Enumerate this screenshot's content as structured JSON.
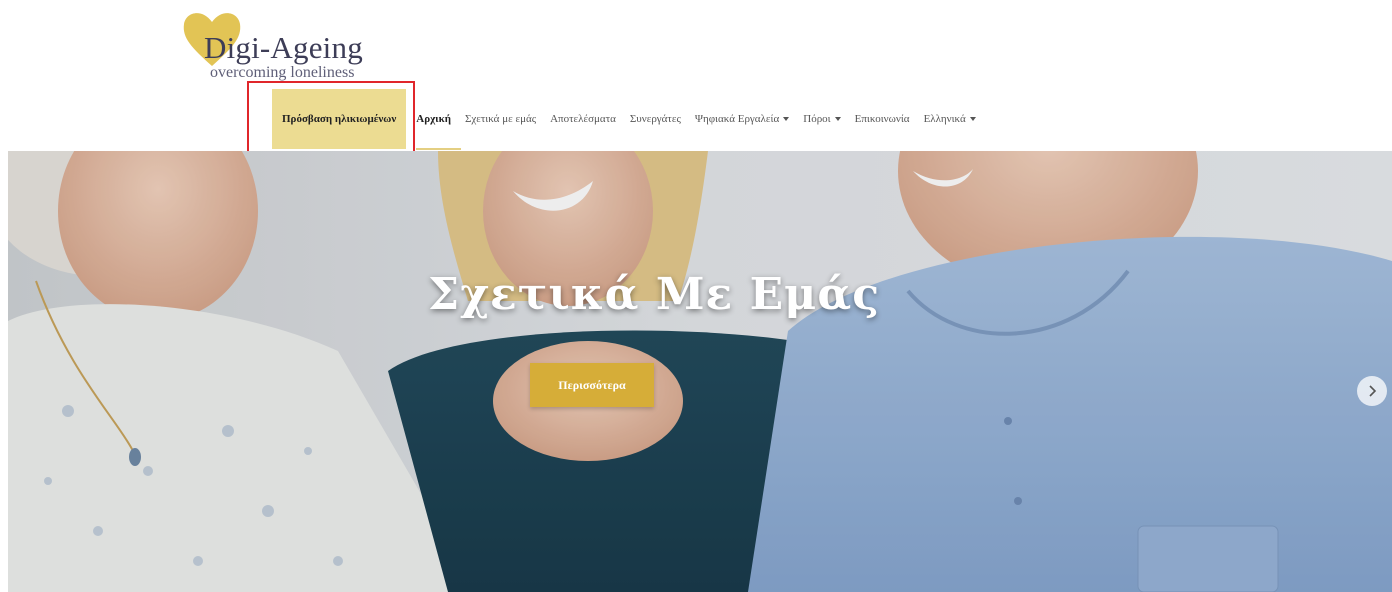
{
  "logo": {
    "title": "Digi-Ageing",
    "tagline": "overcoming loneliness",
    "heart_color": "#e2c455"
  },
  "nav": {
    "items": [
      {
        "label": "Πρόσβαση ηλικιωμένων",
        "highlighted": true
      },
      {
        "label": "Αρχική",
        "active": true
      },
      {
        "label": "Σχετικά με εμάς"
      },
      {
        "label": "Αποτελέσματα"
      },
      {
        "label": "Συνεργάτες"
      },
      {
        "label": "Ψηφιακά Εργαλεία",
        "dropdown": true
      },
      {
        "label": "Πόροι",
        "dropdown": true
      },
      {
        "label": "Επικοινωνία"
      },
      {
        "label": "Ελληνικά",
        "dropdown": true
      }
    ]
  },
  "hero": {
    "title": "Σχετικά Με Εμάς",
    "button_label": "Περισσότερα",
    "next_icon": "chevron-right-icon"
  },
  "colors": {
    "accent": "#d6ad38",
    "nav_highlight": "#ecdc92",
    "annotation_box": "#e0262b"
  }
}
